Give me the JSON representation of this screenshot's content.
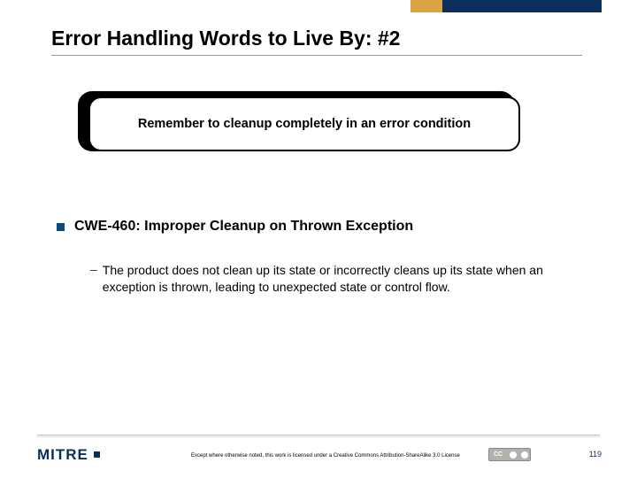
{
  "title": "Error Handling Words to Live By: #2",
  "callout": "Remember to cleanup completely in an error condition",
  "bullet": "CWE-460: Improper Cleanup on Thrown Exception",
  "subbullet": "The product does not clean up its state or incorrectly cleans up its state when an exception is thrown, leading to unexpected state or control flow.",
  "logo": "MITRE",
  "license": "Except where otherwise noted, this work is licensed under a Creative Commons Attribution-ShareAlike 3.0 License",
  "cc_label": "CC",
  "page_number": "119"
}
